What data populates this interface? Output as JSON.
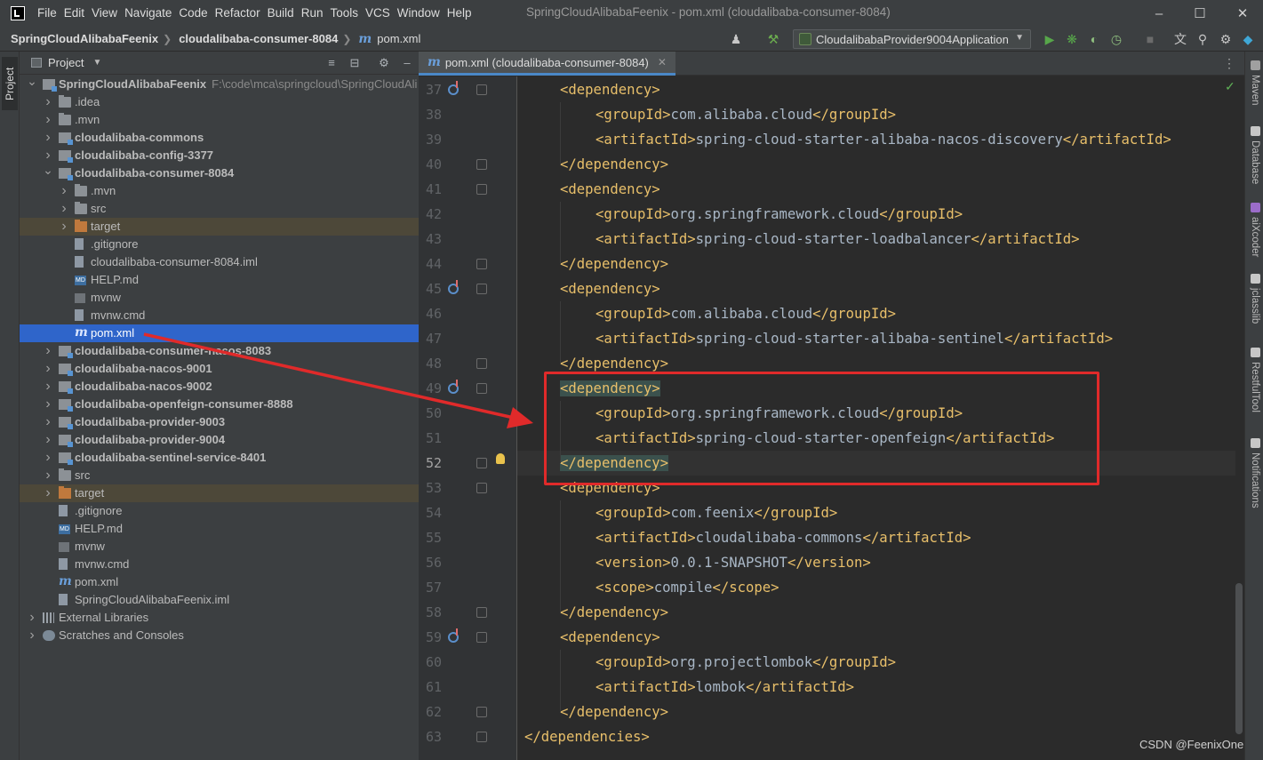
{
  "menubar": {
    "items": [
      "File",
      "Edit",
      "View",
      "Navigate",
      "Code",
      "Refactor",
      "Build",
      "Run",
      "Tools",
      "VCS",
      "Window",
      "Help"
    ],
    "window_title": "SpringCloudAlibabaFeenix - pom.xml (cloudalibaba-consumer-8084)"
  },
  "navbar": {
    "project": "SpringCloudAlibabaFeenix",
    "module": "cloudalibaba-consumer-8084",
    "file": "pom.xml",
    "run_config": "CloudalibabaProvider9004Application"
  },
  "left_stripe": {
    "project_label": "Project"
  },
  "project_panel": {
    "title": "Project",
    "tree": [
      {
        "label": "SpringCloudAlibabaFeenix",
        "path": "F:\\code\\mca\\springcloud\\SpringCloudAli",
        "depth": 0,
        "arrow": "down",
        "icon": "module",
        "bold": true
      },
      {
        "label": ".idea",
        "depth": 1,
        "arrow": "right",
        "icon": "folder"
      },
      {
        "label": ".mvn",
        "depth": 1,
        "arrow": "right",
        "icon": "folder"
      },
      {
        "label": "cloudalibaba-commons",
        "depth": 1,
        "arrow": "right",
        "icon": "module",
        "bold": true
      },
      {
        "label": "cloudalibaba-config-3377",
        "depth": 1,
        "arrow": "right",
        "icon": "module",
        "bold": true
      },
      {
        "label": "cloudalibaba-consumer-8084",
        "depth": 1,
        "arrow": "down",
        "icon": "module",
        "bold": true
      },
      {
        "label": ".mvn",
        "depth": 2,
        "arrow": "right",
        "icon": "folder"
      },
      {
        "label": "src",
        "depth": 2,
        "arrow": "right",
        "icon": "folder"
      },
      {
        "label": "target",
        "depth": 2,
        "arrow": "right",
        "icon": "orange",
        "excluded": true
      },
      {
        "label": ".gitignore",
        "depth": 2,
        "icon": "file"
      },
      {
        "label": "cloudalibaba-consumer-8084.iml",
        "depth": 2,
        "icon": "file"
      },
      {
        "label": "HELP.md",
        "depth": 2,
        "icon": "md"
      },
      {
        "label": "mvnw",
        "depth": 2,
        "icon": "term"
      },
      {
        "label": "mvnw.cmd",
        "depth": 2,
        "icon": "file"
      },
      {
        "label": "pom.xml",
        "depth": 2,
        "icon": "mvn",
        "selected": true
      },
      {
        "label": "cloudalibaba-consumer-nacos-8083",
        "depth": 1,
        "arrow": "right",
        "icon": "module",
        "bold": true
      },
      {
        "label": "cloudalibaba-nacos-9001",
        "depth": 1,
        "arrow": "right",
        "icon": "module",
        "bold": true
      },
      {
        "label": "cloudalibaba-nacos-9002",
        "depth": 1,
        "arrow": "right",
        "icon": "module",
        "bold": true
      },
      {
        "label": "cloudalibaba-openfeign-consumer-8888",
        "depth": 1,
        "arrow": "right",
        "icon": "module",
        "bold": true
      },
      {
        "label": "cloudalibaba-provider-9003",
        "depth": 1,
        "arrow": "right",
        "icon": "module",
        "bold": true
      },
      {
        "label": "cloudalibaba-provider-9004",
        "depth": 1,
        "arrow": "right",
        "icon": "module",
        "bold": true
      },
      {
        "label": "cloudalibaba-sentinel-service-8401",
        "depth": 1,
        "arrow": "right",
        "icon": "module",
        "bold": true
      },
      {
        "label": "src",
        "depth": 1,
        "arrow": "right",
        "icon": "folder"
      },
      {
        "label": "target",
        "depth": 1,
        "arrow": "right",
        "icon": "orange",
        "excluded": true
      },
      {
        "label": ".gitignore",
        "depth": 1,
        "icon": "file"
      },
      {
        "label": "HELP.md",
        "depth": 1,
        "icon": "md"
      },
      {
        "label": "mvnw",
        "depth": 1,
        "icon": "term"
      },
      {
        "label": "mvnw.cmd",
        "depth": 1,
        "icon": "file"
      },
      {
        "label": "pom.xml",
        "depth": 1,
        "icon": "mvn"
      },
      {
        "label": "SpringCloudAlibabaFeenix.iml",
        "depth": 1,
        "icon": "file"
      },
      {
        "label": "External Libraries",
        "depth": 0,
        "arrow": "right",
        "icon": "lib"
      },
      {
        "label": "Scratches and Consoles",
        "depth": 0,
        "arrow": "right",
        "icon": "scratch"
      }
    ]
  },
  "editor": {
    "tab_label": "pom.xml (cloudalibaba-consumer-8084)",
    "current_line": 52,
    "lines": [
      {
        "n": 37,
        "indent": 1,
        "parts": [
          [
            "tag",
            "<dependency>"
          ]
        ],
        "gutter_icon": true
      },
      {
        "n": 38,
        "indent": 2,
        "parts": [
          [
            "tag",
            "<groupId>"
          ],
          [
            "txt",
            "com.alibaba.cloud"
          ],
          [
            "tag",
            "</groupId>"
          ]
        ]
      },
      {
        "n": 39,
        "indent": 2,
        "parts": [
          [
            "tag",
            "<artifactId>"
          ],
          [
            "txt",
            "spring-cloud-starter-alibaba-nacos-discovery"
          ],
          [
            "tag",
            "</artifactId>"
          ]
        ]
      },
      {
        "n": 40,
        "indent": 1,
        "parts": [
          [
            "tag",
            "</dependency>"
          ]
        ]
      },
      {
        "n": 41,
        "indent": 1,
        "parts": [
          [
            "tag",
            "<dependency>"
          ]
        ]
      },
      {
        "n": 42,
        "indent": 2,
        "parts": [
          [
            "tag",
            "<groupId>"
          ],
          [
            "txt",
            "org.springframework.cloud"
          ],
          [
            "tag",
            "</groupId>"
          ]
        ]
      },
      {
        "n": 43,
        "indent": 2,
        "parts": [
          [
            "tag",
            "<artifactId>"
          ],
          [
            "txt",
            "spring-cloud-starter-loadbalancer"
          ],
          [
            "tag",
            "</artifactId>"
          ]
        ]
      },
      {
        "n": 44,
        "indent": 1,
        "parts": [
          [
            "tag",
            "</dependency>"
          ]
        ]
      },
      {
        "n": 45,
        "indent": 1,
        "parts": [
          [
            "tag",
            "<dependency>"
          ]
        ],
        "gutter_icon": true
      },
      {
        "n": 46,
        "indent": 2,
        "parts": [
          [
            "tag",
            "<groupId>"
          ],
          [
            "txt",
            "com.alibaba.cloud"
          ],
          [
            "tag",
            "</groupId>"
          ]
        ]
      },
      {
        "n": 47,
        "indent": 2,
        "parts": [
          [
            "tag",
            "<artifactId>"
          ],
          [
            "txt",
            "spring-cloud-starter-alibaba-sentinel"
          ],
          [
            "tag",
            "</artifactId>"
          ]
        ]
      },
      {
        "n": 48,
        "indent": 1,
        "parts": [
          [
            "tag",
            "</dependency>"
          ]
        ]
      },
      {
        "n": 49,
        "indent": 1,
        "parts": [
          [
            "tag",
            "<dependency>"
          ]
        ],
        "gutter_icon": true,
        "highlight": true
      },
      {
        "n": 50,
        "indent": 2,
        "parts": [
          [
            "tag",
            "<groupId>"
          ],
          [
            "txt",
            "org.springframework.cloud"
          ],
          [
            "tag",
            "</groupId>"
          ]
        ]
      },
      {
        "n": 51,
        "indent": 2,
        "parts": [
          [
            "tag",
            "<artifactId>"
          ],
          [
            "txt",
            "spring-cloud-starter-openfeign"
          ],
          [
            "tag",
            "</artifactId>"
          ]
        ]
      },
      {
        "n": 52,
        "indent": 1,
        "parts": [
          [
            "tag",
            "</dependency>"
          ]
        ],
        "highlight": true
      },
      {
        "n": 53,
        "indent": 1,
        "parts": [
          [
            "tag",
            "<dependency>"
          ]
        ]
      },
      {
        "n": 54,
        "indent": 2,
        "parts": [
          [
            "tag",
            "<groupId>"
          ],
          [
            "txt",
            "com.feenix"
          ],
          [
            "tag",
            "</groupId>"
          ]
        ]
      },
      {
        "n": 55,
        "indent": 2,
        "parts": [
          [
            "tag",
            "<artifactId>"
          ],
          [
            "txt",
            "cloudalibaba-commons"
          ],
          [
            "tag",
            "</artifactId>"
          ]
        ]
      },
      {
        "n": 56,
        "indent": 2,
        "parts": [
          [
            "tag",
            "<version>"
          ],
          [
            "txt",
            "0.0.1-SNAPSHOT"
          ],
          [
            "tag",
            "</version>"
          ]
        ]
      },
      {
        "n": 57,
        "indent": 2,
        "parts": [
          [
            "tag",
            "<scope>"
          ],
          [
            "txt",
            "compile"
          ],
          [
            "tag",
            "</scope>"
          ]
        ]
      },
      {
        "n": 58,
        "indent": 1,
        "parts": [
          [
            "tag",
            "</dependency>"
          ]
        ]
      },
      {
        "n": 59,
        "indent": 1,
        "parts": [
          [
            "tag",
            "<dependency>"
          ]
        ],
        "gutter_icon": true
      },
      {
        "n": 60,
        "indent": 2,
        "parts": [
          [
            "tag",
            "<groupId>"
          ],
          [
            "txt",
            "org.projectlombok"
          ],
          [
            "tag",
            "</groupId>"
          ]
        ]
      },
      {
        "n": 61,
        "indent": 2,
        "parts": [
          [
            "tag",
            "<artifactId>"
          ],
          [
            "txt",
            "lombok"
          ],
          [
            "tag",
            "</artifactId>"
          ]
        ]
      },
      {
        "n": 62,
        "indent": 1,
        "parts": [
          [
            "tag",
            "</dependency>"
          ]
        ]
      },
      {
        "n": 63,
        "indent": 0,
        "parts": [
          [
            "tag",
            "</dependencies>"
          ]
        ]
      }
    ]
  },
  "right_stripe": {
    "items": [
      "Maven",
      "Database",
      "aiXcoder",
      "jclasslib",
      "RestfulTool",
      "Notifications"
    ]
  },
  "colors": {
    "accent": "#2f65ca",
    "tag": "#e8bf6a",
    "text": "#a9b7c6",
    "annotation": "#e02a2a"
  },
  "watermark": "CSDN @FeenixOne"
}
